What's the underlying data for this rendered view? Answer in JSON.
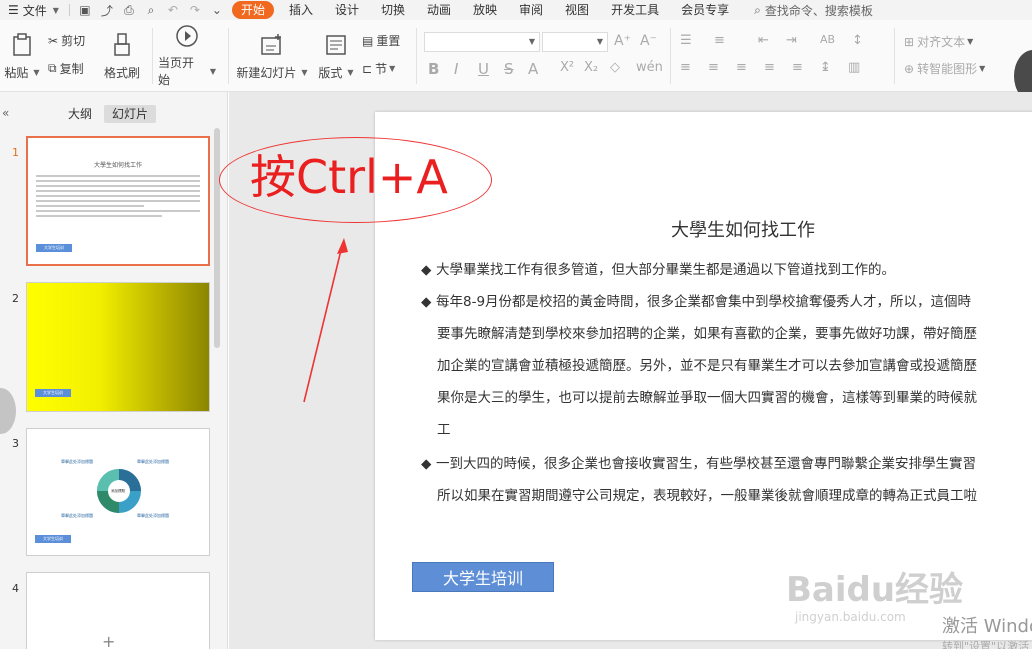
{
  "menubar": {
    "file_label": "文件",
    "tabs": [
      "开始",
      "插入",
      "设计",
      "切换",
      "动画",
      "放映",
      "审阅",
      "视图",
      "开发工具",
      "会员专享"
    ],
    "search_label": "查找命令、搜索模板"
  },
  "ribbon": {
    "paste": "粘贴",
    "cut": "剪切",
    "copy": "复制",
    "format_painter": "格式刷",
    "from_current": "当页开始",
    "new_slide": "新建幻灯片",
    "layout": "版式",
    "reset": "重置",
    "section": "节",
    "align_text": "对齐文本",
    "smart_graphic": "转智能图形"
  },
  "left_panel": {
    "outline_tab": "大纲",
    "slides_tab": "幻灯片",
    "slide_numbers": [
      "1",
      "2",
      "3",
      "4"
    ],
    "thumb1_title": "大學生如何找工作",
    "thumb_button": "大学生培训",
    "thumb3_labels": [
      "單擊此处添加標題",
      "單擊此处添加標題",
      "單擊此处添加標題",
      "單擊此处添加標題"
    ],
    "thumb3_center": "添加標題"
  },
  "slide": {
    "title": "大學生如何找工作",
    "bullets": [
      "大學畢業找工作有很多管道，但大部分畢業生都是通過以下管道找到工作的。",
      "每年8-9月份都是校招的黃金時間，很多企業都會集中到學校搶奪優秀人才，所以，這個時",
      "一到大四的時候，很多企業也會接收實習生，有些學校甚至還會專門聯繫企業安排學生實習"
    ],
    "continuation_1": [
      "要事先瞭解清楚到學校來參加招聘的企業，如果有喜歡的企業，要事先做好功課，帶好簡歷",
      "加企業的宣講會並積極投遞簡歷。另外，並不是只有畢業生才可以去參加宣講會或投遞簡歷",
      "果你是大三的學生，也可以提前去瞭解並爭取一個大四實習的機會，這樣等到畢業的時候就",
      "工"
    ],
    "continuation_3": [
      "所以如果在實習期間遵守公司規定，表現較好，一般畢業後就會順理成章的轉為正式員工啦"
    ],
    "button_label": "大学生培训"
  },
  "annotation": {
    "text": "按Ctrl+A",
    "color": "#ea2020"
  },
  "watermark": {
    "logo": "Baidu经验",
    "url": "jingyan.baidu.com",
    "activate": "激活 Windows",
    "activate_sub": "转到\"设置\"以激活"
  },
  "colors": {
    "accent": "#f0691f",
    "slide_button": "#5e8fd6",
    "thumb_active_border": "#e8704b"
  }
}
